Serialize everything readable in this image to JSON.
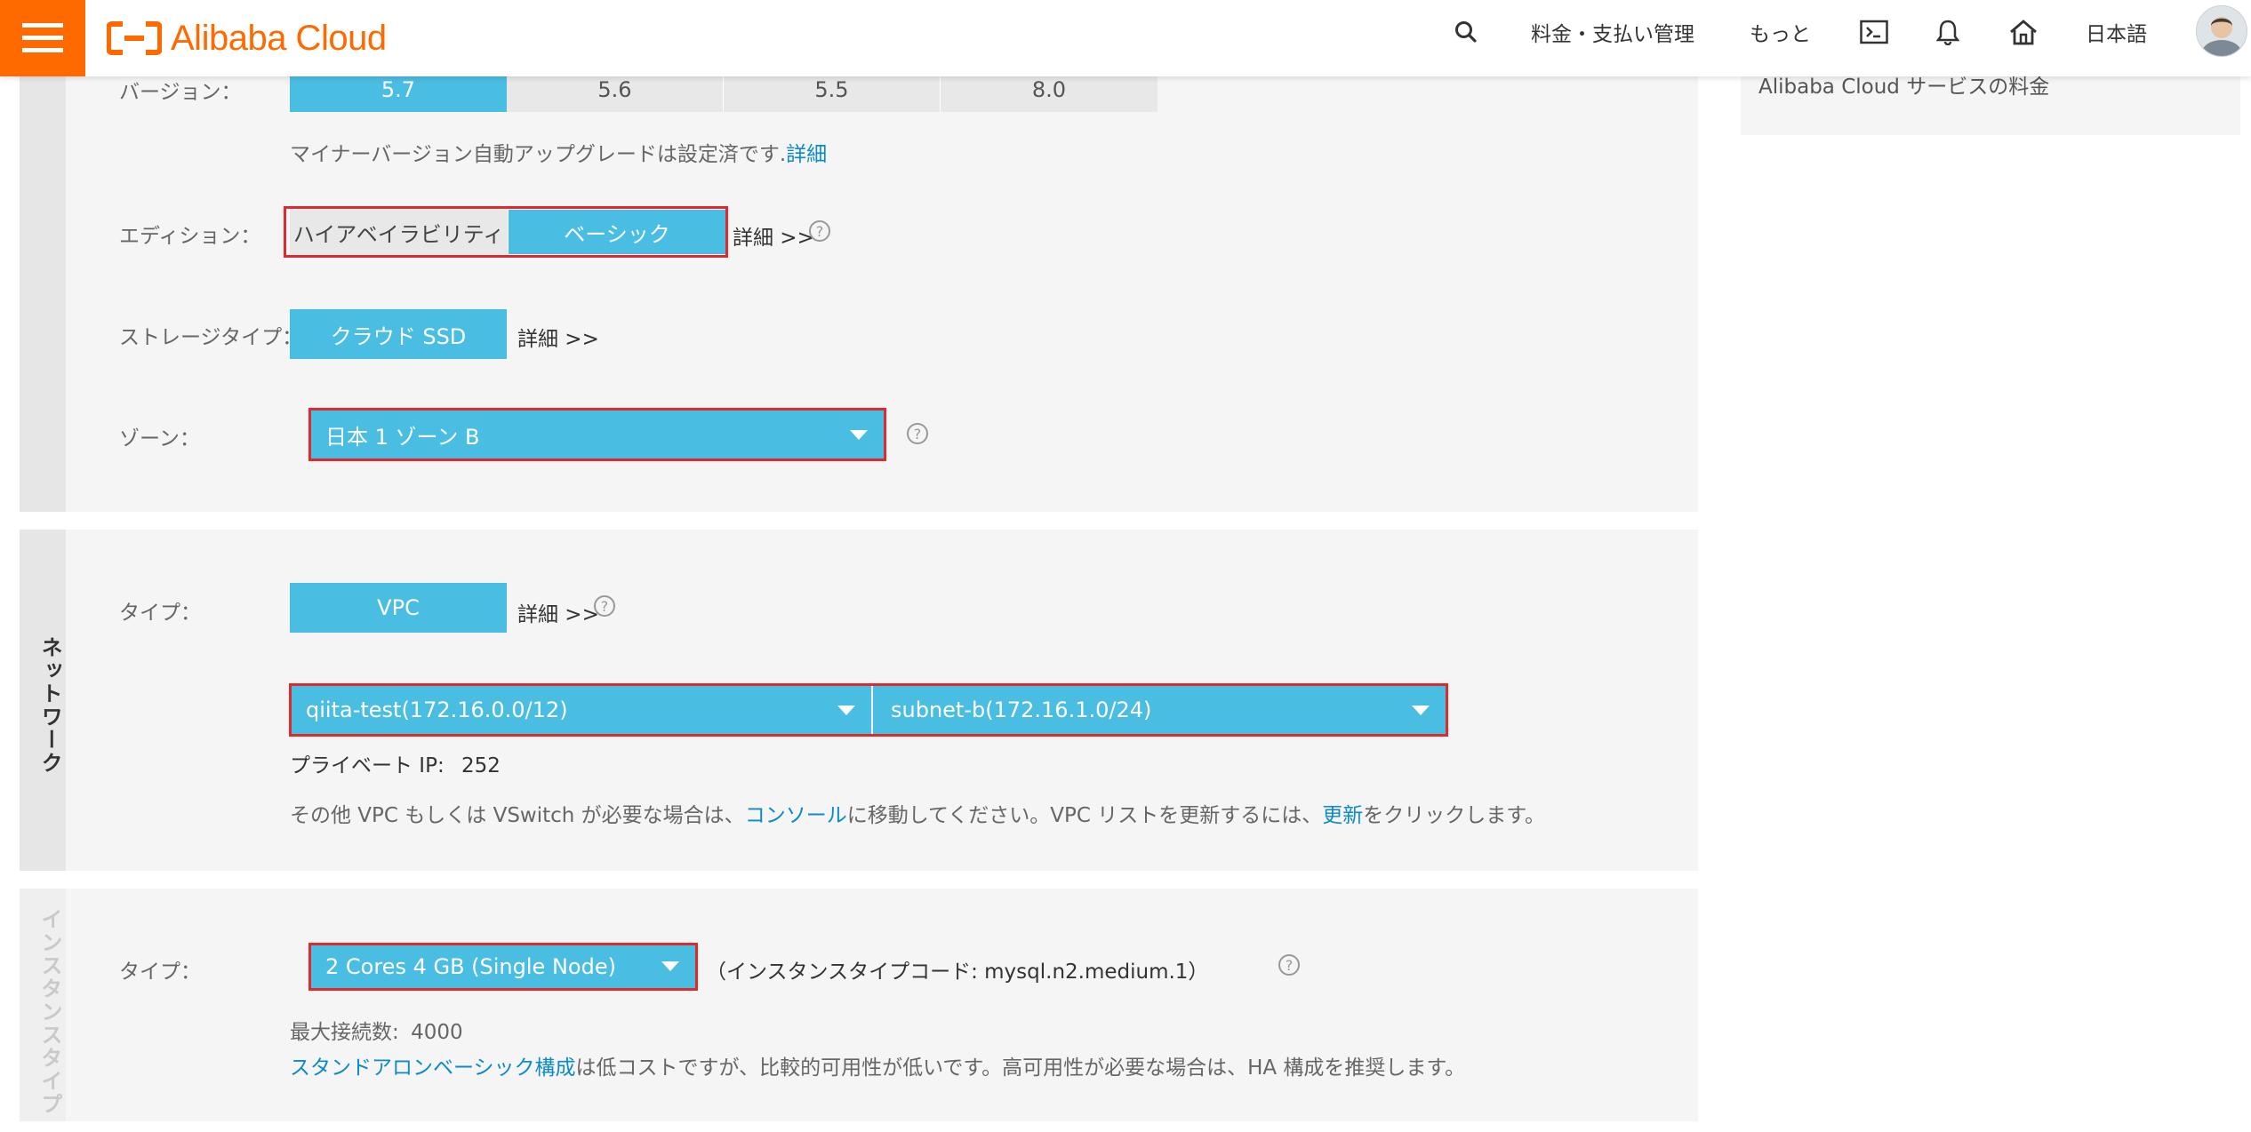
{
  "header": {
    "logo_text": "Alibaba Cloud",
    "nav": {
      "billing": "料金・支払い管理",
      "more": "もっと",
      "language": "日本語"
    },
    "icons": [
      "menu-icon",
      "search-icon",
      "terminal-icon",
      "bell-icon",
      "home-icon"
    ]
  },
  "right_panel": {
    "text": "Alibaba Cloud サービスの料金"
  },
  "basic": {
    "version_label": "バージョン：",
    "versions": [
      "5.7",
      "5.6",
      "5.5",
      "8.0"
    ],
    "selected_version": "5.7",
    "minor_upgrade_note": "マイナーバージョン自動アップグレードは設定済です.",
    "minor_upgrade_link": "詳細",
    "edition_label": "エディション：",
    "edition_ha": "ハイアベイラビリティ",
    "edition_basic": "ベーシック",
    "details": "詳細 >>",
    "storage_label": "ストレージタイプ：",
    "storage_type": "クラウド SSD",
    "zone_label": "ゾーン：",
    "zone_value": "日本 1 ゾーン B"
  },
  "network": {
    "tab_label": "ネットワーク",
    "type_label": "タイプ：",
    "type_value": "VPC",
    "details": "詳細 >>",
    "vpc_value": "qiita-test(172.16.0.0/12)",
    "vswitch_value": "subnet-b(172.16.1.0/24)",
    "private_ip_label": "プライベート IP:",
    "private_ip_value": "252",
    "note_prefix": "その他 VPC もしくは VSwitch が必要な場合は、",
    "note_console_link": "コンソール",
    "note_middle": "に移動してください。VPC リストを更新するには、",
    "note_refresh_link": "更新",
    "note_suffix": "をクリックします。"
  },
  "instance": {
    "tab_label": "インスタンスタイプ",
    "type_label": "タイプ：",
    "type_value": "2 Cores 4 GB (Single Node)",
    "type_code": "（インスタンスタイプコード: mysql.n2.medium.1）",
    "max_conn_label": "最大接続数:",
    "max_conn_value": "4000",
    "standalone_link": "スタンドアロンベーシック構成",
    "standalone_note": "は低コストですが、比較的可用性が低いです。高可用性が必要な場合は、HA 構成を推奨します。"
  },
  "colors": {
    "brand_orange": "#ff6a00",
    "active_blue": "#4abde2",
    "highlight_red": "#e0292d",
    "link_blue": "#0d8ac7"
  }
}
